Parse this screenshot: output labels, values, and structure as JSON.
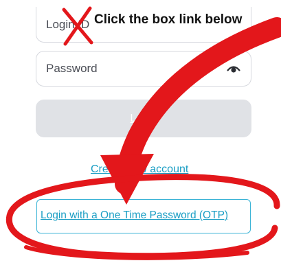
{
  "form": {
    "login_placeholder": "Login ID",
    "password_placeholder": "Password",
    "login_button": "Login",
    "create_account": "Create new account",
    "otp_link": "Login with a One Time Password (OTP)"
  },
  "annotation": {
    "instruction": "Click the box link below"
  },
  "icons": {
    "password_toggle": "eye-icon",
    "cross": "x-mark-icon",
    "arrow": "curved-arrow-icon"
  },
  "colors": {
    "accent": "#1a9ec4",
    "annotation": "#e3171b",
    "button_disabled": "#e0e2e6"
  }
}
